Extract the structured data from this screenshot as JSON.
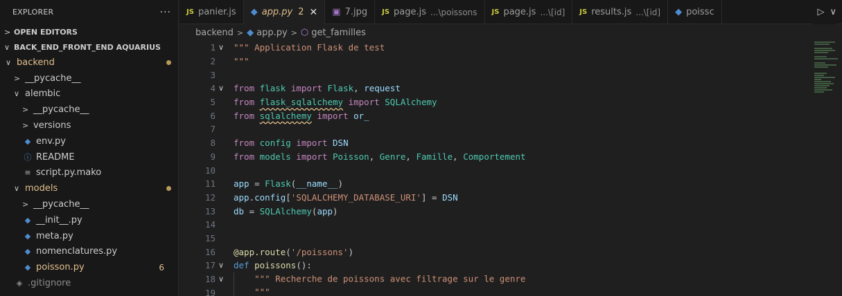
{
  "sidebar": {
    "title": "EXPLORER",
    "more": "···",
    "open_editors": "OPEN EDITORS",
    "workspace": "BACK_END_FRONT_END AQUARIUS",
    "tree": [
      {
        "label": "backend",
        "kind": "folder-open",
        "depth": 1,
        "modified": true,
        "dot": true
      },
      {
        "label": "__pycache__",
        "kind": "folder-closed",
        "depth": 2
      },
      {
        "label": "alembic",
        "kind": "folder-open",
        "depth": 2
      },
      {
        "label": "__pycache__",
        "kind": "folder-closed",
        "depth": 3
      },
      {
        "label": "versions",
        "kind": "folder-closed",
        "depth": 3
      },
      {
        "label": "env.py",
        "kind": "py",
        "depth": 3
      },
      {
        "label": "README",
        "kind": "info",
        "depth": 3
      },
      {
        "label": "script.py.mako",
        "kind": "mako",
        "depth": 3
      },
      {
        "label": "models",
        "kind": "folder-open",
        "depth": 2,
        "modified": true,
        "dot": true
      },
      {
        "label": "__pycache__",
        "kind": "folder-closed",
        "depth": 3
      },
      {
        "label": "__init__.py",
        "kind": "py",
        "depth": 3
      },
      {
        "label": "meta.py",
        "kind": "py",
        "depth": 3
      },
      {
        "label": "nomenclatures.py",
        "kind": "py",
        "depth": 3
      },
      {
        "label": "poisson.py",
        "kind": "py",
        "depth": 3,
        "modified": true,
        "count": "6"
      },
      {
        "label": ".gitignore",
        "kind": "git",
        "depth": 2
      }
    ]
  },
  "tabs": [
    {
      "name": "panier.js",
      "icon": "JS",
      "kind": "js"
    },
    {
      "name": "app.py",
      "icon": "py",
      "kind": "py",
      "active": true,
      "count": "2",
      "close": "✕"
    },
    {
      "name": "7.jpg",
      "icon": "img",
      "kind": "img"
    },
    {
      "name": "page.js",
      "desc": "...\\poissons",
      "icon": "JS",
      "kind": "js"
    },
    {
      "name": "page.js",
      "desc": "...\\[id]",
      "icon": "JS",
      "kind": "js"
    },
    {
      "name": "results.js",
      "desc": "...\\[id]",
      "icon": "JS",
      "kind": "js"
    },
    {
      "name": "poissc",
      "icon": "py",
      "kind": "py"
    }
  ],
  "breadcrumb": {
    "folder": "backend",
    "file": "app.py",
    "symbol": "get_familles"
  },
  "editor": {
    "lines": [
      {
        "n": "1",
        "fold": "∨",
        "html": "<span class=\"str\">\"\"\" Application Flask de test</span>"
      },
      {
        "n": "2",
        "html": "<span class=\"str\">\"\"\"</span>"
      },
      {
        "n": "3",
        "html": ""
      },
      {
        "n": "4",
        "fold": "∨",
        "html": "<span class=\"kw\">from</span> <span class=\"cls\">flask</span> <span class=\"kw\">import</span> <span class=\"cls\">Flask</span>, <span class=\"var\">request</span>"
      },
      {
        "n": "5",
        "html": "<span class=\"kw\">from</span> <span class=\"cls squig\">flask_sqlalchemy</span> <span class=\"kw\">import</span> <span class=\"cls\">SQLAlchemy</span>"
      },
      {
        "n": "6",
        "html": "<span class=\"kw\">from</span> <span class=\"cls squig\">sqlalchemy</span> <span class=\"kw\">import</span> <span class=\"var\">or_</span>"
      },
      {
        "n": "7",
        "html": ""
      },
      {
        "n": "8",
        "html": "<span class=\"kw\">from</span> <span class=\"cls\">config</span> <span class=\"kw\">import</span> <span class=\"var\">DSN</span>"
      },
      {
        "n": "9",
        "html": "<span class=\"kw\">from</span> <span class=\"cls\">models</span> <span class=\"kw\">import</span> <span class=\"cls\">Poisson</span>, <span class=\"cls\">Genre</span>, <span class=\"cls\">Famille</span>, <span class=\"cls\">Comportement</span>"
      },
      {
        "n": "10",
        "html": ""
      },
      {
        "n": "11",
        "html": "<span class=\"var\">app</span> = <span class=\"cls\">Flask</span>(<span class=\"var\">__name__</span>)"
      },
      {
        "n": "12",
        "html": "<span class=\"var\">app</span>.<span class=\"var\">config</span>[<span class=\"str\">'SQLALCHEMY_DATABASE_URI'</span>] = <span class=\"var\">DSN</span>"
      },
      {
        "n": "13",
        "html": "<span class=\"var\">db</span> = <span class=\"cls\">SQLAlchemy</span>(<span class=\"var\">app</span>)"
      },
      {
        "n": "14",
        "html": ""
      },
      {
        "n": "15",
        "html": ""
      },
      {
        "n": "16",
        "html": "<span class=\"dec\">@app.route</span>(<span class=\"str\">'/poissons'</span>)"
      },
      {
        "n": "17",
        "fold": "∨",
        "html": "<span class=\"kw2\">def</span> <span class=\"fn\">poissons</span>():"
      },
      {
        "n": "18",
        "fold": "∨",
        "guide": true,
        "html": "<span class=\"str\">\"\"\" Recherche de poissons avec filtrage sur le genre</span>"
      },
      {
        "n": "19",
        "guide": true,
        "html": "<span class=\"str\">\"\"\"</span>"
      }
    ]
  },
  "colors": {
    "accent_modified": "#e2c08d",
    "python_icon": "#4f8ccf",
    "js_icon": "#cbcb41"
  }
}
